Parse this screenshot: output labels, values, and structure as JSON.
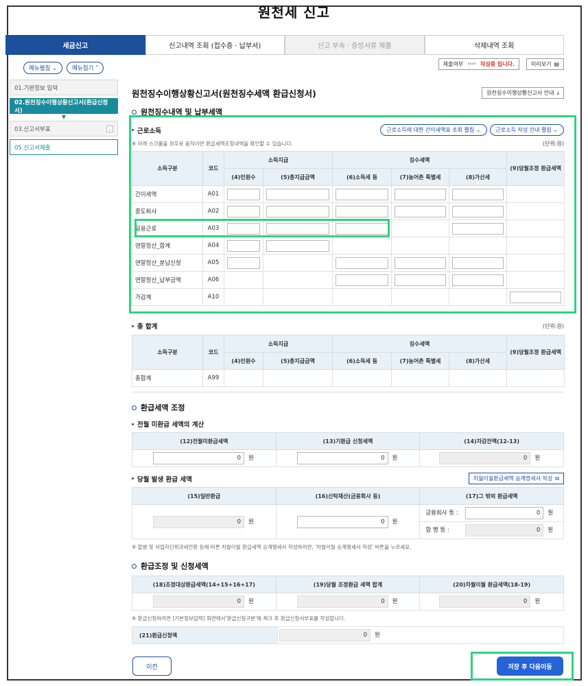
{
  "page_title": "원천세 신고",
  "tabs": [
    {
      "label": "세금신고",
      "state": "active"
    },
    {
      "label": "신고내역 조회 (접수증 · 납부서)",
      "state": "normal"
    },
    {
      "label": "신고 부속 · 증빙서류 제출",
      "state": "disabled"
    },
    {
      "label": "삭제내역 조회",
      "state": "normal"
    }
  ],
  "sidebar": {
    "menu_expand": "메뉴펼침",
    "menu_collapse": "메뉴접기",
    "items": [
      {
        "label": "01.기본정보 입력"
      },
      {
        "label": "02.원천징수이행상황신고서(환급신청서)"
      },
      {
        "label": "03.신고서부표"
      },
      {
        "label": "05.신고서제출"
      }
    ]
  },
  "topbar": {
    "status_label": "제출여부",
    "status_arrows": "››››",
    "status_value": "작성중 입니다.",
    "preview": "미리보기"
  },
  "form": {
    "title": "원천징수이행상황신고서(원천징수세액 환급신청서)",
    "guide_button": "원천징수이행상황신고서 안내",
    "section1_title": "원천징수내역 및 납부세액",
    "earned_income": {
      "title": "근로소득",
      "btn_simple_tax": "근로소득에 대한 간이세액표 조회 펼침",
      "btn_guide": "근로소득 작성 안내 펼침",
      "note": "※ 아래 스크롤을 좌우로 움직이면 환급세액조정내역을 확인할 수 있습니다.",
      "unit": "(단위:원)",
      "headers": {
        "income_type": "소득구분",
        "code": "코드",
        "income_paid": "소득지급",
        "tax_collected": "징수세액",
        "headcount": "(4)인원수",
        "total_paid": "(5)총지급금액",
        "income_tax": "(6)소득세 등",
        "rural_tax": "(7)농어촌 특별세",
        "additional_tax": "(8)가산세",
        "refund_adjust": "(9)당월조정 환급세액"
      },
      "rows": [
        {
          "type": "간이세액",
          "code": "A01"
        },
        {
          "type": "중도퇴사",
          "code": "A02"
        },
        {
          "type": "일용근로",
          "code": "A03"
        },
        {
          "type": "연말정산_합계",
          "code": "A04"
        },
        {
          "type": "연말정산_분납신청",
          "code": "A05"
        },
        {
          "type": "연말정산_납부금액",
          "code": "A06"
        },
        {
          "type": "가감계",
          "code": "A10"
        }
      ]
    },
    "total": {
      "title": "총 합계",
      "unit": "(단위:원)",
      "row": {
        "type": "총합계",
        "code": "A99"
      }
    },
    "refund": {
      "title": "환급세액 조정",
      "prev_title": "전월 미환급 세액의 계산",
      "prev_headers": [
        "(12)전월미환급세액",
        "(13)기환급 신청세액",
        "(14)차감잔액(12-13)"
      ],
      "prev_values": [
        "0",
        "0",
        "0"
      ],
      "won": "원",
      "curr_title": "당월 발생 환급 세액",
      "curr_button": "차월이월환급세액 승계명세서 작성",
      "curr_headers": [
        "(15)일반환급",
        "(16)신탁재산(금융회사 등)",
        "(17)그 밖의 환급세액"
      ],
      "curr_values": [
        "0",
        "0"
      ],
      "financial_label": "금융회사 등 :",
      "financial_value": "0",
      "merger_label": "합 병 등 :",
      "merger_value": "0",
      "curr_note": "※ 합병 및 사업자단위과세전환 등에 따른 차월이월 환급세액 승계명세서 작성하려면, '차월이월 승계명세서 작성' 버튼을 누르세요."
    },
    "adjust": {
      "title": "환급조정 및 신청세액",
      "headers": [
        "(18)조정대상환급세액(14+15+16+17)",
        "(19)당월 조정환급 세액 합계",
        "(20)차월이월 환급세액(18-19)"
      ],
      "values": [
        "0",
        "0",
        "0"
      ],
      "note": "※ 환급신청하려면 [기본정보입력] 화면에서'환급신청구분'에 체크 후 환급신청서부표를 작성합니다.",
      "apply_label": "(21)환급신청액",
      "apply_value": "0"
    }
  },
  "buttons": {
    "prev": "이전",
    "save_next": "저장 후 다음이동"
  },
  "colors": {
    "primary": "#1c4f9c",
    "teal": "#1a8b9a",
    "highlight": "#2ed37e",
    "action": "#2563d6"
  }
}
